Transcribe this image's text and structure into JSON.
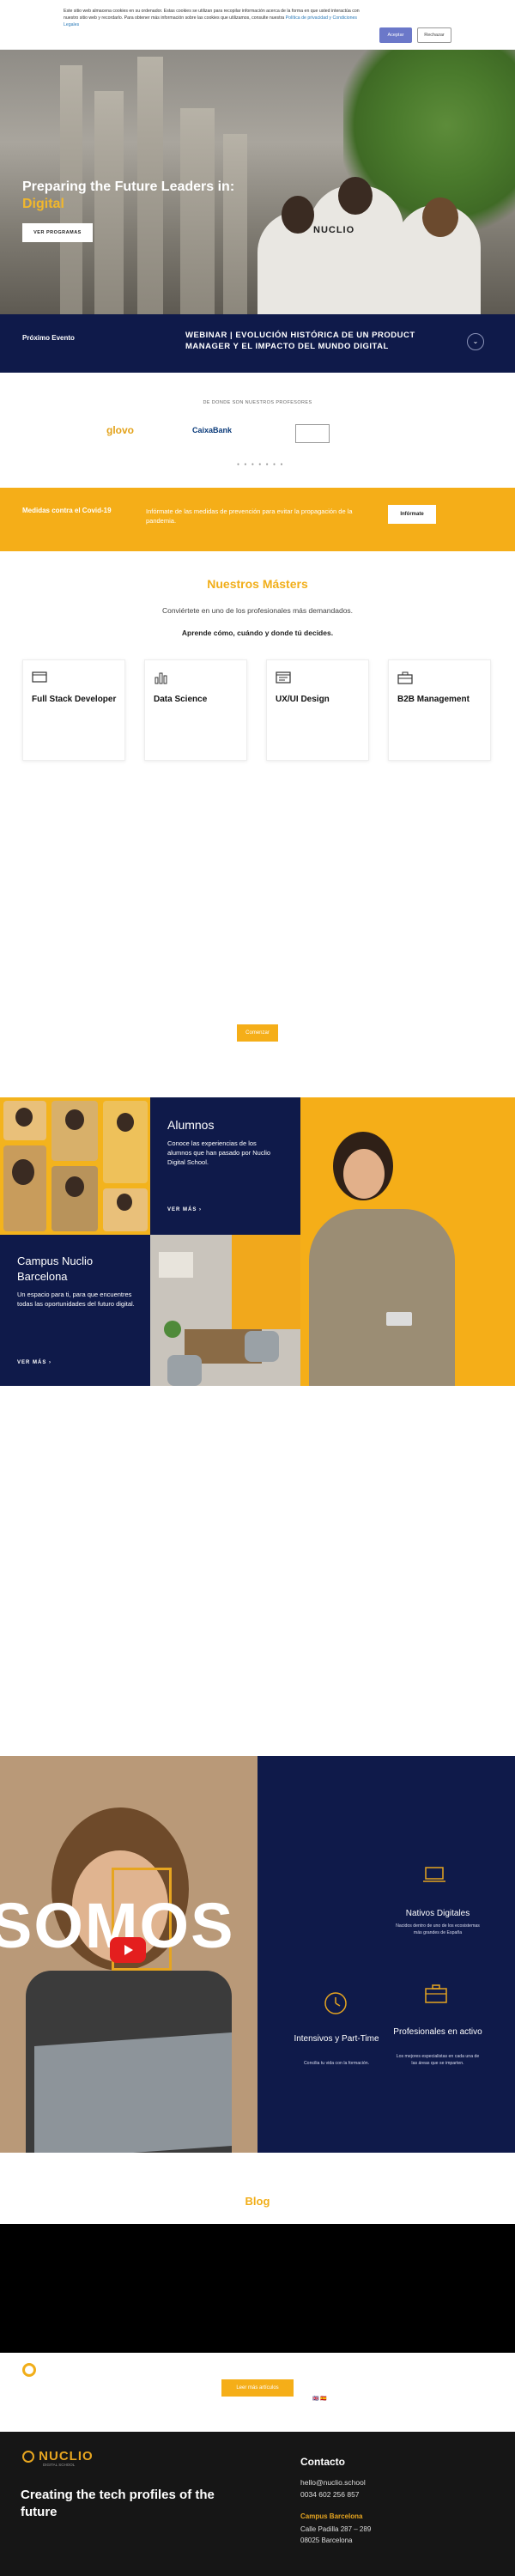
{
  "cookie": {
    "text": "Este sitio web almacena cookies en su ordenador. Estas cookies se utilizan para recopilar información acerca de la forma en que usted interactúa con nuestro sitio web y recordarlo. Para obtener más información sobre las cookies que utilizamos, consulte nuestra",
    "link": "Política de privacidad y Condiciones Legales",
    "accept_label": "Aceptar",
    "reject_label": "Rechazar"
  },
  "hero": {
    "title_line1": "Preparing the Future Leaders in:",
    "title_line2": "Digital",
    "button_label": "VER PROGRAMAS",
    "shirt_text": "NUCLIO"
  },
  "event": {
    "label": "Próximo Evento",
    "title": "WEBINAR | EVOLUCIÓN HISTÓRICA DE UN PRODUCT MANAGER Y EL IMPACTO DEL MUNDO DIGITAL",
    "chevron": "⌄"
  },
  "partners": {
    "label": "DE DONDE SON NUESTROS PROFESORES",
    "logos": [
      "glovo",
      "CaixaBank",
      "—",
      "—"
    ],
    "caixa_sub": "",
    "dots": "● ● ● ● ● ● ●"
  },
  "covid": {
    "label": "Medidas contra el Covid-19",
    "text": "Infórmate de las medidas de prevención para evitar la propagación de la pandemia.",
    "button_label": "Infórmate"
  },
  "masters": {
    "title": "Nuestros Másters",
    "subtitle": "Conviértete en uno de los profesionales más demandados.",
    "subtitle2": "Aprende cómo, cuándo y donde tú decides.",
    "cards": [
      {
        "title": "Full Stack Developer",
        "icon": "laptop-icon"
      },
      {
        "title": "Data Science",
        "icon": "bar-chart-icon"
      },
      {
        "title": "UX/UI Design",
        "icon": "browser-icon"
      },
      {
        "title": "B2B Management",
        "icon": "briefcase-icon"
      }
    ],
    "button_label": "Comenzar"
  },
  "alumni": {
    "title": "Alumnos",
    "text": "Conoce las experiencias de los alumnos que han pasado por Nuclio Digital School.",
    "link": "VER MÁS ›"
  },
  "campus": {
    "title": "Campus Nuclio Barcelona",
    "text": "Un espacio para ti, para que encuentres todas las oportunidades del futuro digital.",
    "link": "VER MÁS ›"
  },
  "somos": {
    "word": "SOMOS",
    "features": [
      {
        "title": "Nativos Digitales",
        "text": "Nacidos dentro de uno de los ecosistemas más grandes de España",
        "icon": "laptop-icon"
      },
      {
        "title": "Intensivos y Part-Time",
        "text": "Concilia tu vida con la formación.",
        "icon": "clock-icon"
      },
      {
        "title": "Profesionales en activo",
        "text": "Los mejores especialistas en cada una de las áreas que se imparten.",
        "icon": "briefcase-icon"
      }
    ]
  },
  "blog": {
    "title": "Blog",
    "button_label": "Leer más artículos",
    "flags": "🇬🇧 🇪🇸"
  },
  "footer": {
    "logo": "NUCLIO",
    "logo_sub": "DIGITAL SCHOOL",
    "tagline": "Creating the tech profiles of the future",
    "contact_title": "Contacto",
    "email": "hello@nuclio.school",
    "phone": "0034 602 256 857",
    "campus_label": "Campus Barcelona",
    "address1": "Calle Padilla 287 – 289",
    "address2": "08025 Barcelona"
  },
  "colors": {
    "navy": "#0f1a4a",
    "yellow": "#f5ae18",
    "accent_blue": "#6b78c9"
  }
}
